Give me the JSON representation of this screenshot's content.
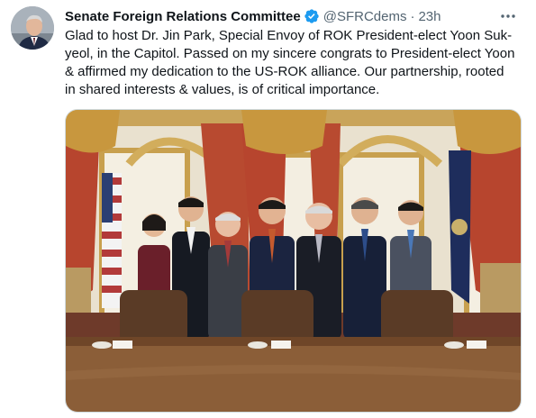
{
  "tweet": {
    "author_name": "Senate Foreign Relations Committee",
    "handle": "@SFRCdems",
    "separator": "·",
    "time": "23h",
    "text_lines": [
      "Glad to host Dr. Jin Park, Special Envoy of ROK President-elect Yoon Suk-",
      "yeol, in the Capitol. Passed on my sincere congrats to President-elect Yoon",
      "& affirmed my dedication to the US-ROK alliance. Our partnership, rooted",
      "in shared interests & values, is of critical importance."
    ]
  },
  "icons": {
    "verified": "verified-badge-icon",
    "more": "more-options-icon"
  },
  "colors": {
    "verified_blue": "#1d9bf0",
    "secondary_text": "#536471",
    "primary_text": "#0f1419"
  }
}
